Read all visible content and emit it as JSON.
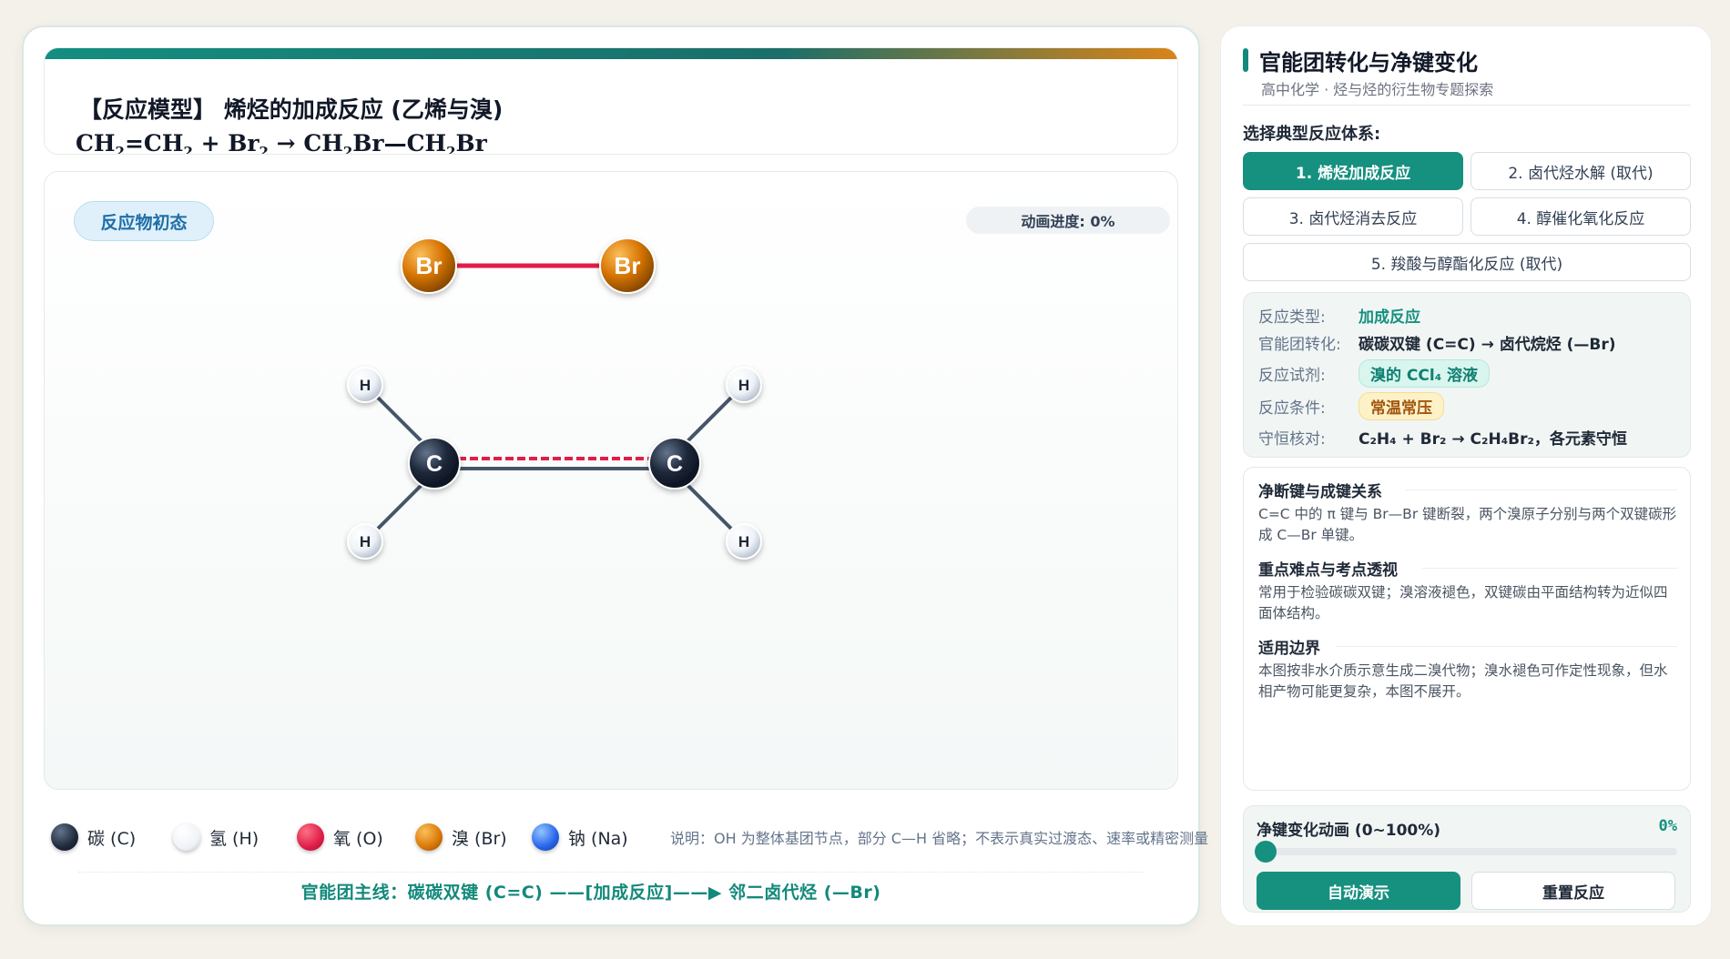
{
  "model": {
    "title": "【反应模型】 烯烃的加成反应 (乙烯与溴)",
    "equation_parts": [
      "CH",
      "2",
      "=CH",
      "2",
      " + Br",
      "2",
      " → CH",
      "2",
      "Br—CH",
      "2",
      "Br"
    ]
  },
  "stage": {
    "badge": "反应物初态",
    "progress": "动画进度: 0%",
    "atoms": {
      "br_label": "Br",
      "c_label": "C",
      "h_label": "H"
    }
  },
  "legend": {
    "items": [
      {
        "label": "碳 (C)",
        "color": "#1e293b"
      },
      {
        "label": "氢 (H)",
        "color": "#eef2f7"
      },
      {
        "label": "氧 (O)",
        "color": "#e11d48"
      },
      {
        "label": "溴 (Br)",
        "color": "#d97706"
      },
      {
        "label": "钠 (Na)",
        "color": "#2563eb"
      }
    ],
    "note": "说明：OH 为整体基团节点，部分 C—H 省略；不表示真实过渡态、速率或精密测量"
  },
  "mainline": "官能团主线：碳碳双键 (C=C) ——[加成反应]——▶ 邻二卤代烃 (—Br)",
  "side": {
    "title": "官能团转化与净键变化",
    "subtitle": "高中化学 · 烃与烃的衍生物专题探索",
    "select_label": "选择典型反应体系:",
    "reactions": [
      {
        "label": "1. 烯烃加成反应",
        "active": true
      },
      {
        "label": "2. 卤代烃水解 (取代)",
        "active": false
      },
      {
        "label": "3. 卤代烃消去反应",
        "active": false
      },
      {
        "label": "4. 醇催化氧化反应",
        "active": false
      },
      {
        "label": "5. 羧酸与醇酯化反应 (取代)",
        "active": false
      }
    ],
    "info": {
      "type_key": "反应类型:",
      "type_val": "加成反应",
      "fg_key": "官能团转化:",
      "fg_val": "碳碳双键 (C=C) → 卤代烷烃 (—Br)",
      "reagent_key": "反应试剂:",
      "reagent_val": "溴的 CCl₄ 溶液",
      "condition_key": "反应条件:",
      "condition_val": "常温常压",
      "conserve_key": "守恒核对:",
      "conserve_val": "C₂H₄ + Br₂ → C₂H₄Br₂，各元素守恒"
    },
    "notes": [
      {
        "head": "净断键与成键关系",
        "body": "C=C 中的 π 键与 Br—Br 键断裂，两个溴原子分别与两个双键碳形成 C—Br 单键。"
      },
      {
        "head": "重点难点与考点透视",
        "body": "常用于检验碳碳双键；溴溶液褪色，双键碳由平面结构转为近似四面体结构。"
      },
      {
        "head": "适用边界",
        "body": "本图按非水介质示意生成二溴代物；溴水褪色可作定性现象，但水相产物可能更复杂，本图不展开。"
      }
    ],
    "anim": {
      "label": "净键变化动画 (0~100%)",
      "pct": "0%",
      "value": 0,
      "auto_btn": "自动演示",
      "reset_btn": "重置反应"
    }
  }
}
